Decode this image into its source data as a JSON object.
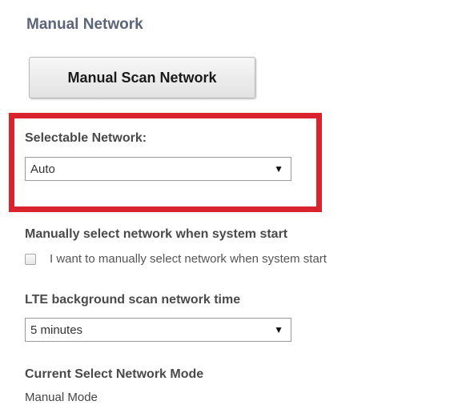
{
  "section": {
    "title": "Manual Network"
  },
  "scan_button": {
    "label": "Manual Scan Network"
  },
  "selectable_network": {
    "label": "Selectable Network:",
    "selected": "Auto",
    "arrow": "▼"
  },
  "manual_select": {
    "label": "Manually select network when system start",
    "checkbox_label": "I want to manually select network when system start",
    "checked": false
  },
  "lte_scan_time": {
    "label": "LTE background scan network time",
    "selected": "5 minutes",
    "arrow": "▼"
  },
  "current_mode": {
    "label": "Current Select Network Mode",
    "value": "Manual Mode"
  },
  "colors": {
    "highlight": "#d9232d",
    "title": "#5b6478"
  },
  "icons": {
    "dropdown": "triangle-down",
    "checkbox": "checkbox-unchecked"
  }
}
